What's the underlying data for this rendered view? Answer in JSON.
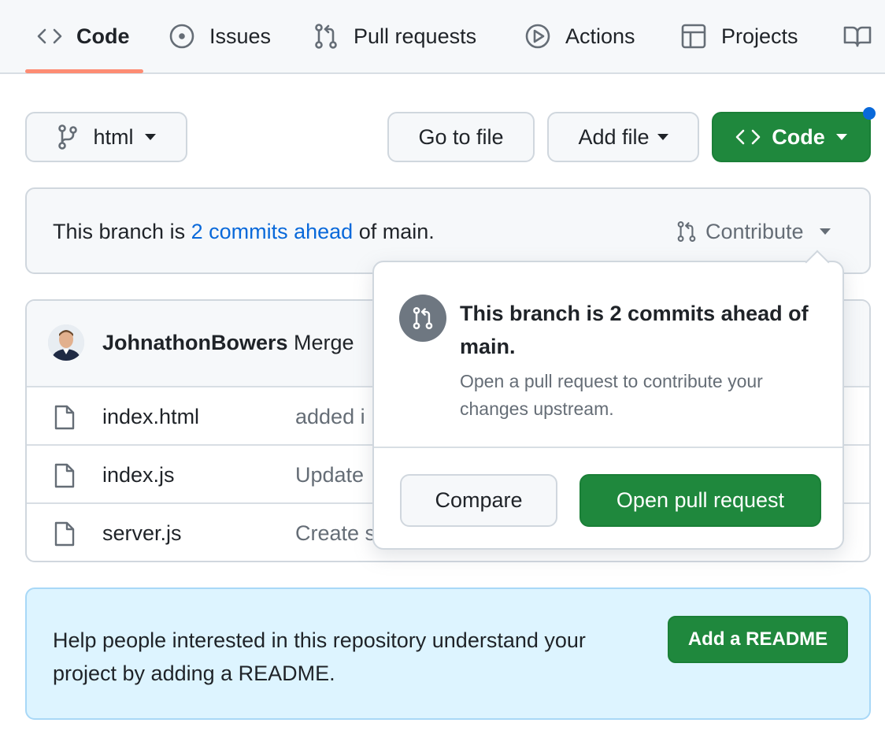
{
  "nav": {
    "tabs": [
      {
        "label": "Code",
        "icon": "code-icon"
      },
      {
        "label": "Issues",
        "icon": "issue-opened-icon"
      },
      {
        "label": "Pull requests",
        "icon": "pull-request-icon"
      },
      {
        "label": "Actions",
        "icon": "play-icon"
      },
      {
        "label": "Projects",
        "icon": "table-icon"
      },
      {
        "label": "",
        "icon": "book-icon"
      }
    ]
  },
  "toolbar": {
    "branch_label": "html",
    "go_to_file_label": "Go to file",
    "add_file_label": "Add file",
    "code_button_label": "Code"
  },
  "branch_banner": {
    "prefix": "This branch is ",
    "link_text": "2 commits ahead",
    "suffix": " of main.",
    "contribute_label": "Contribute"
  },
  "commit": {
    "author": "JohnathonBowers",
    "message": "Merge"
  },
  "files": [
    {
      "name": "index.html",
      "message": "added i"
    },
    {
      "name": "index.js",
      "message": "Update"
    },
    {
      "name": "server.js",
      "message": "Create s"
    }
  ],
  "popover": {
    "title": "This branch is 2 commits ahead of main.",
    "description": "Open a pull request to contribute your changes upstream.",
    "compare_label": "Compare",
    "open_pr_label": "Open pull request"
  },
  "readme_banner": {
    "text": "Help people interested in this repository understand your project by adding a README.",
    "button_label": "Add a README"
  },
  "colors": {
    "accent_green": "#1f883d",
    "link_blue": "#0969da",
    "tab_underline": "#fd8c73",
    "notification_dot": "#0969da",
    "readme_bg": "#ddf4ff"
  }
}
